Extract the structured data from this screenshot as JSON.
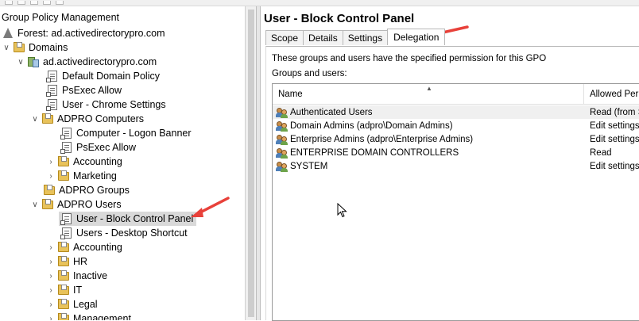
{
  "colors": {
    "accent": "#e8413a",
    "selection": "#d9d9d9",
    "folder": "#e8c25a"
  },
  "tree": {
    "title": "Group Policy Management",
    "items": [
      {
        "label": "Forest: ad.activedirectorypro.com",
        "icon": "forest-icon"
      },
      {
        "label": "Domains",
        "icon": "folder-icon"
      },
      {
        "label": "ad.activedirectorypro.com",
        "icon": "domain-icon"
      },
      {
        "label": "Default Domain Policy",
        "icon": "gpo-link-icon"
      },
      {
        "label": "PsExec Allow",
        "icon": "gpo-link-icon"
      },
      {
        "label": "User - Chrome Settings",
        "icon": "gpo-link-icon"
      },
      {
        "label": "ADPRO Computers",
        "icon": "ou-folder-icon"
      },
      {
        "label": "Computer - Logon Banner",
        "icon": "gpo-link-icon"
      },
      {
        "label": "PsExec Allow",
        "icon": "gpo-link-icon"
      },
      {
        "label": "Accounting",
        "icon": "ou-folder-icon"
      },
      {
        "label": "Marketing",
        "icon": "ou-folder-icon"
      },
      {
        "label": "ADPRO Groups",
        "icon": "ou-folder-icon"
      },
      {
        "label": "ADPRO Users",
        "icon": "ou-folder-icon"
      },
      {
        "label": "User - Block Control Panel",
        "icon": "gpo-link-icon",
        "selected": true
      },
      {
        "label": "Users - Desktop Shortcut",
        "icon": "gpo-link-icon"
      },
      {
        "label": "Accounting",
        "icon": "ou-folder-icon"
      },
      {
        "label": "HR",
        "icon": "ou-folder-icon"
      },
      {
        "label": "Inactive",
        "icon": "ou-folder-icon"
      },
      {
        "label": "IT",
        "icon": "ou-folder-icon"
      },
      {
        "label": "Legal",
        "icon": "ou-folder-icon"
      },
      {
        "label": "Management",
        "icon": "ou-folder-icon"
      }
    ]
  },
  "detail": {
    "title": "User - Block Control Panel",
    "tabs": [
      {
        "label": "Scope"
      },
      {
        "label": "Details"
      },
      {
        "label": "Settings"
      },
      {
        "label": "Delegation",
        "active": true
      }
    ],
    "description": "These groups and users have the specified permission for this GPO",
    "list_label": "Groups and users:",
    "columns": {
      "name": "Name",
      "permission": "Allowed Perm"
    },
    "rows": [
      {
        "name": "Authenticated Users",
        "permission": "Read (from S"
      },
      {
        "name": "Domain Admins (adpro\\Domain Admins)",
        "permission": "Edit settings,"
      },
      {
        "name": "Enterprise Admins (adpro\\Enterprise Admins)",
        "permission": "Edit settings,"
      },
      {
        "name": "ENTERPRISE DOMAIN CONTROLLERS",
        "permission": "Read"
      },
      {
        "name": "SYSTEM",
        "permission": "Edit settings,"
      }
    ]
  }
}
